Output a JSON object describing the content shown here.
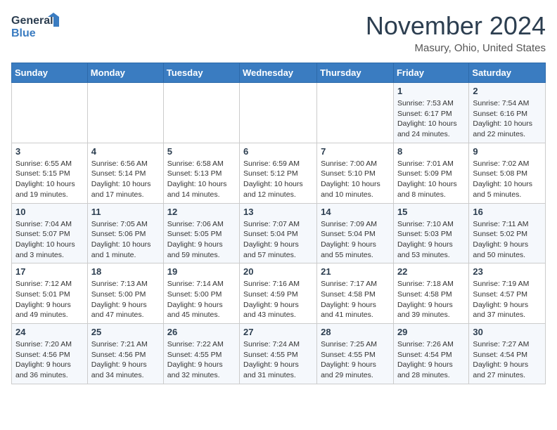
{
  "header": {
    "logo_line1": "General",
    "logo_line2": "Blue",
    "month_title": "November 2024",
    "location": "Masury, Ohio, United States"
  },
  "weekdays": [
    "Sunday",
    "Monday",
    "Tuesday",
    "Wednesday",
    "Thursday",
    "Friday",
    "Saturday"
  ],
  "weeks": [
    [
      {
        "day": "",
        "info": ""
      },
      {
        "day": "",
        "info": ""
      },
      {
        "day": "",
        "info": ""
      },
      {
        "day": "",
        "info": ""
      },
      {
        "day": "",
        "info": ""
      },
      {
        "day": "1",
        "info": "Sunrise: 7:53 AM\nSunset: 6:17 PM\nDaylight: 10 hours\nand 24 minutes."
      },
      {
        "day": "2",
        "info": "Sunrise: 7:54 AM\nSunset: 6:16 PM\nDaylight: 10 hours\nand 22 minutes."
      }
    ],
    [
      {
        "day": "3",
        "info": "Sunrise: 6:55 AM\nSunset: 5:15 PM\nDaylight: 10 hours\nand 19 minutes."
      },
      {
        "day": "4",
        "info": "Sunrise: 6:56 AM\nSunset: 5:14 PM\nDaylight: 10 hours\nand 17 minutes."
      },
      {
        "day": "5",
        "info": "Sunrise: 6:58 AM\nSunset: 5:13 PM\nDaylight: 10 hours\nand 14 minutes."
      },
      {
        "day": "6",
        "info": "Sunrise: 6:59 AM\nSunset: 5:12 PM\nDaylight: 10 hours\nand 12 minutes."
      },
      {
        "day": "7",
        "info": "Sunrise: 7:00 AM\nSunset: 5:10 PM\nDaylight: 10 hours\nand 10 minutes."
      },
      {
        "day": "8",
        "info": "Sunrise: 7:01 AM\nSunset: 5:09 PM\nDaylight: 10 hours\nand 8 minutes."
      },
      {
        "day": "9",
        "info": "Sunrise: 7:02 AM\nSunset: 5:08 PM\nDaylight: 10 hours\nand 5 minutes."
      }
    ],
    [
      {
        "day": "10",
        "info": "Sunrise: 7:04 AM\nSunset: 5:07 PM\nDaylight: 10 hours\nand 3 minutes."
      },
      {
        "day": "11",
        "info": "Sunrise: 7:05 AM\nSunset: 5:06 PM\nDaylight: 10 hours\nand 1 minute."
      },
      {
        "day": "12",
        "info": "Sunrise: 7:06 AM\nSunset: 5:05 PM\nDaylight: 9 hours\nand 59 minutes."
      },
      {
        "day": "13",
        "info": "Sunrise: 7:07 AM\nSunset: 5:04 PM\nDaylight: 9 hours\nand 57 minutes."
      },
      {
        "day": "14",
        "info": "Sunrise: 7:09 AM\nSunset: 5:04 PM\nDaylight: 9 hours\nand 55 minutes."
      },
      {
        "day": "15",
        "info": "Sunrise: 7:10 AM\nSunset: 5:03 PM\nDaylight: 9 hours\nand 53 minutes."
      },
      {
        "day": "16",
        "info": "Sunrise: 7:11 AM\nSunset: 5:02 PM\nDaylight: 9 hours\nand 50 minutes."
      }
    ],
    [
      {
        "day": "17",
        "info": "Sunrise: 7:12 AM\nSunset: 5:01 PM\nDaylight: 9 hours\nand 49 minutes."
      },
      {
        "day": "18",
        "info": "Sunrise: 7:13 AM\nSunset: 5:00 PM\nDaylight: 9 hours\nand 47 minutes."
      },
      {
        "day": "19",
        "info": "Sunrise: 7:14 AM\nSunset: 5:00 PM\nDaylight: 9 hours\nand 45 minutes."
      },
      {
        "day": "20",
        "info": "Sunrise: 7:16 AM\nSunset: 4:59 PM\nDaylight: 9 hours\nand 43 minutes."
      },
      {
        "day": "21",
        "info": "Sunrise: 7:17 AM\nSunset: 4:58 PM\nDaylight: 9 hours\nand 41 minutes."
      },
      {
        "day": "22",
        "info": "Sunrise: 7:18 AM\nSunset: 4:58 PM\nDaylight: 9 hours\nand 39 minutes."
      },
      {
        "day": "23",
        "info": "Sunrise: 7:19 AM\nSunset: 4:57 PM\nDaylight: 9 hours\nand 37 minutes."
      }
    ],
    [
      {
        "day": "24",
        "info": "Sunrise: 7:20 AM\nSunset: 4:56 PM\nDaylight: 9 hours\nand 36 minutes."
      },
      {
        "day": "25",
        "info": "Sunrise: 7:21 AM\nSunset: 4:56 PM\nDaylight: 9 hours\nand 34 minutes."
      },
      {
        "day": "26",
        "info": "Sunrise: 7:22 AM\nSunset: 4:55 PM\nDaylight: 9 hours\nand 32 minutes."
      },
      {
        "day": "27",
        "info": "Sunrise: 7:24 AM\nSunset: 4:55 PM\nDaylight: 9 hours\nand 31 minutes."
      },
      {
        "day": "28",
        "info": "Sunrise: 7:25 AM\nSunset: 4:55 PM\nDaylight: 9 hours\nand 29 minutes."
      },
      {
        "day": "29",
        "info": "Sunrise: 7:26 AM\nSunset: 4:54 PM\nDaylight: 9 hours\nand 28 minutes."
      },
      {
        "day": "30",
        "info": "Sunrise: 7:27 AM\nSunset: 4:54 PM\nDaylight: 9 hours\nand 27 minutes."
      }
    ]
  ]
}
